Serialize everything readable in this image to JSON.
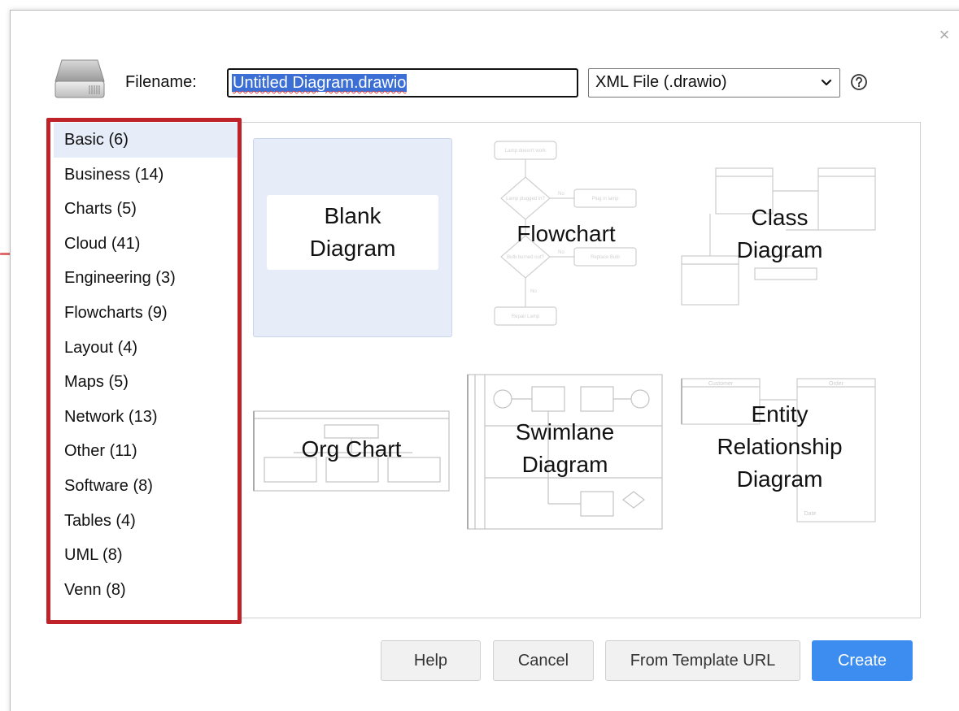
{
  "header": {
    "filename_label": "Filename:",
    "filename_value": "Untitled Diagram.drawio",
    "format_selected": "XML File (.drawio)"
  },
  "categories": [
    "Basic (6)",
    "Business (14)",
    "Charts (5)",
    "Cloud (41)",
    "Engineering (3)",
    "Flowcharts (9)",
    "Layout (4)",
    "Maps (5)",
    "Network (13)",
    "Other (11)",
    "Software (8)",
    "Tables (4)",
    "UML (8)",
    "Venn (8)"
  ],
  "templates": {
    "blank": "Blank\nDiagram",
    "flowchart": "Flowchart",
    "class": "Class\nDiagram",
    "org": "Org Chart",
    "swimlane": "Swimlane\nDiagram",
    "er": "Entity\nRelationship\nDiagram"
  },
  "flowchart_thumb": {
    "lamp_doesnt_work": "Lamp doesn't work",
    "lamp_plugged_in": "Lamp plugged in?",
    "no1": "No",
    "plug_in_lamp": "Plug in lamp",
    "bulb_burned_out": "Bulb burned out?",
    "no2": "No",
    "replace_bulb": "Replace Bulb",
    "no3": "No",
    "repair_lamp": "Repair Lamp"
  },
  "er_thumb": {
    "customer": "Customer",
    "order": "Order",
    "date": "Date"
  },
  "buttons": {
    "help": "Help",
    "cancel": "Cancel",
    "from_template_url": "From Template URL",
    "create": "Create"
  },
  "colors": {
    "accent": "#3d8df0",
    "highlight": "#c0222a",
    "selected_bg": "#e6edf8"
  },
  "icons": {
    "close": "close-icon",
    "drive": "drive-icon",
    "help": "help-circle-icon",
    "chevron": "chevron-down-icon"
  }
}
